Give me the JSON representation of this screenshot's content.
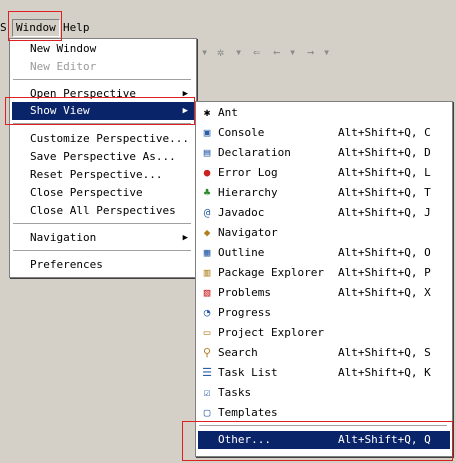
{
  "menubar": {
    "window_label": "Window",
    "help_label": "Help",
    "left_fragment": "S"
  },
  "window_menu": {
    "items": [
      {
        "label": "New Window",
        "enabled": true
      },
      {
        "label": "New Editor",
        "enabled": false
      },
      {
        "label": "Open Perspective",
        "enabled": true,
        "submenu": true
      },
      {
        "label": "Show View",
        "enabled": true,
        "submenu": true,
        "highlighted": true
      },
      {
        "label": "Customize Perspective...",
        "enabled": true
      },
      {
        "label": "Save Perspective As...",
        "enabled": true
      },
      {
        "label": "Reset Perspective...",
        "enabled": true
      },
      {
        "label": "Close Perspective",
        "enabled": true
      },
      {
        "label": "Close All Perspectives",
        "enabled": true
      },
      {
        "label": "Navigation",
        "enabled": true,
        "submenu": true
      },
      {
        "label": "Preferences",
        "enabled": true
      }
    ]
  },
  "show_view_menu": {
    "items": [
      {
        "label": "Ant",
        "shortcut": "",
        "icon": "ant-icon"
      },
      {
        "label": "Console",
        "shortcut": "Alt+Shift+Q, C",
        "icon": "console-icon"
      },
      {
        "label": "Declaration",
        "shortcut": "Alt+Shift+Q, D",
        "icon": "declaration-icon"
      },
      {
        "label": "Error Log",
        "shortcut": "Alt+Shift+Q, L",
        "icon": "error-log-icon"
      },
      {
        "label": "Hierarchy",
        "shortcut": "Alt+Shift+Q, T",
        "icon": "hierarchy-icon"
      },
      {
        "label": "Javadoc",
        "shortcut": "Alt+Shift+Q, J",
        "icon": "javadoc-icon"
      },
      {
        "label": "Navigator",
        "shortcut": "",
        "icon": "navigator-icon"
      },
      {
        "label": "Outline",
        "shortcut": "Alt+Shift+Q, O",
        "icon": "outline-icon"
      },
      {
        "label": "Package Explorer",
        "shortcut": "Alt+Shift+Q, P",
        "icon": "package-explorer-icon"
      },
      {
        "label": "Problems",
        "shortcut": "Alt+Shift+Q, X",
        "icon": "problems-icon"
      },
      {
        "label": "Progress",
        "shortcut": "",
        "icon": "progress-icon"
      },
      {
        "label": "Project Explorer",
        "shortcut": "",
        "icon": "project-explorer-icon"
      },
      {
        "label": "Search",
        "shortcut": "Alt+Shift+Q, S",
        "icon": "search-icon"
      },
      {
        "label": "Task List",
        "shortcut": "Alt+Shift+Q, K",
        "icon": "task-list-icon"
      },
      {
        "label": "Tasks",
        "shortcut": "",
        "icon": "tasks-icon"
      },
      {
        "label": "Templates",
        "shortcut": "",
        "icon": "templates-icon"
      },
      {
        "label": "Other...",
        "shortcut": "Alt+Shift+Q, Q",
        "icon": "",
        "highlighted": true
      }
    ]
  },
  "colors": {
    "highlight": "#0a246a",
    "annotation": "#e02020",
    "menu_bg": "#ffffff",
    "chrome": "#d4d0c8"
  }
}
